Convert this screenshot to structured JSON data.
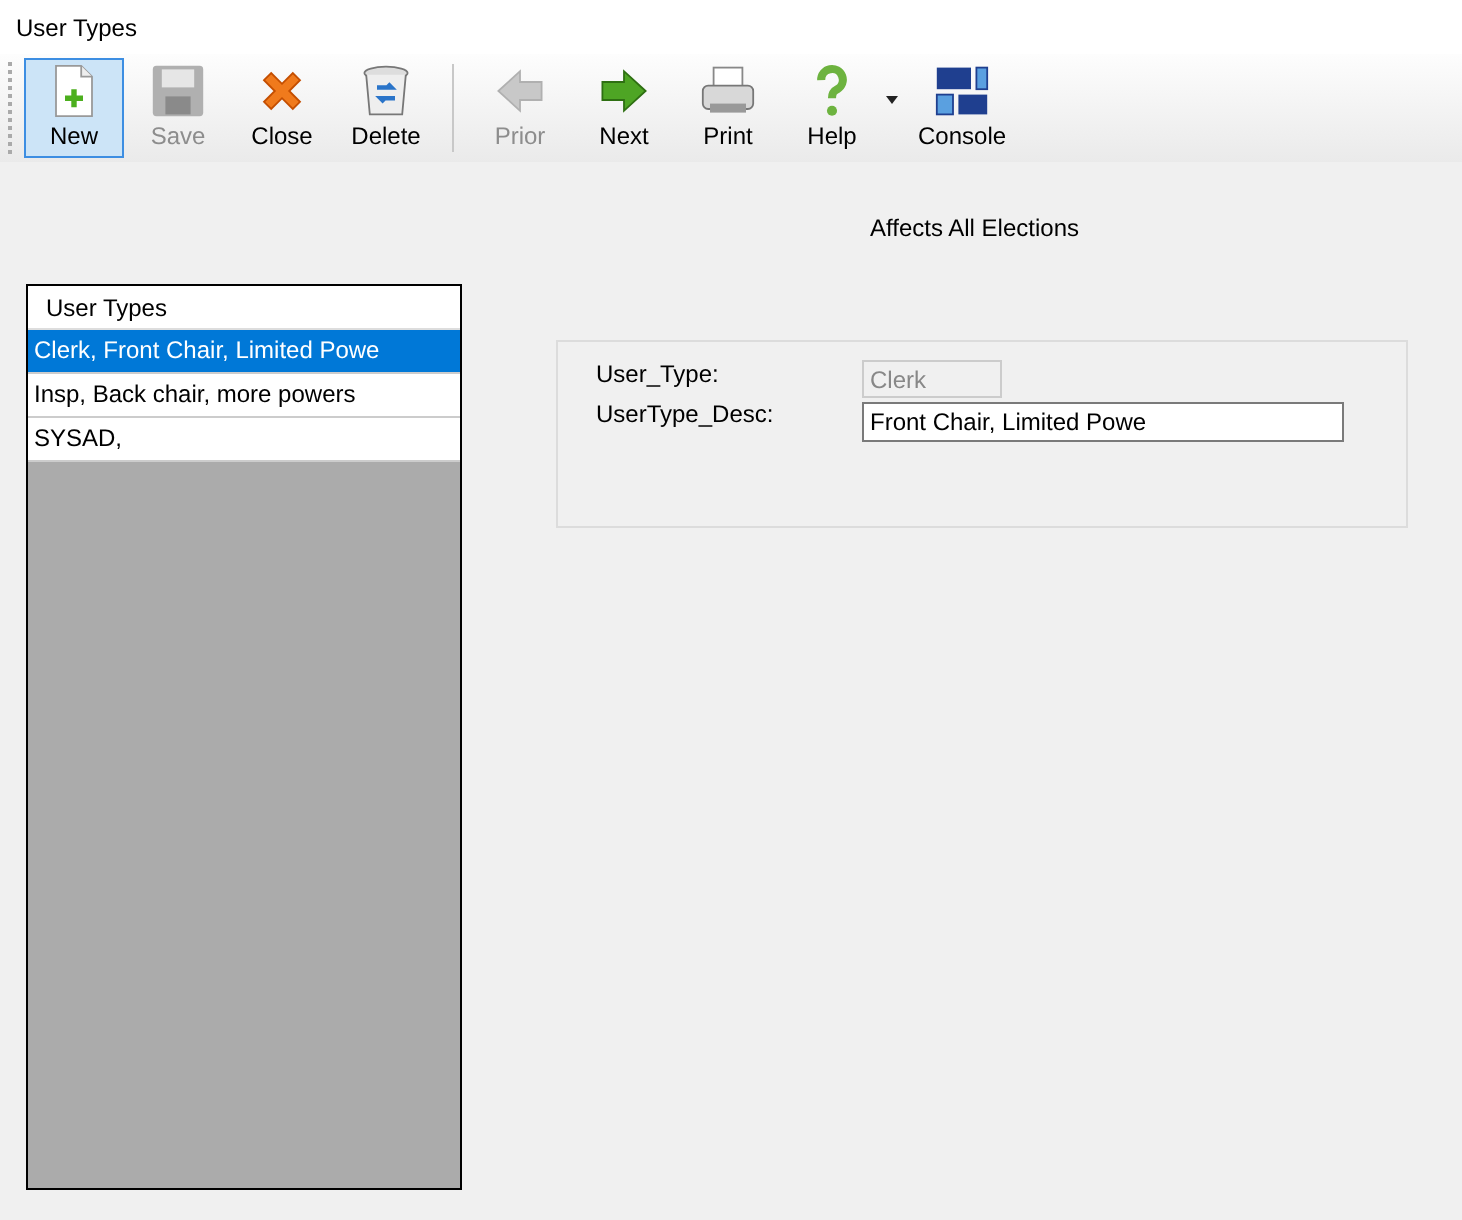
{
  "window": {
    "title": "User Types"
  },
  "toolbar": [
    {
      "kind": "new",
      "label": "New",
      "selected": true,
      "disabled": false
    },
    {
      "kind": "save",
      "label": "Save",
      "selected": false,
      "disabled": true
    },
    {
      "kind": "close",
      "label": "Close",
      "selected": false,
      "disabled": false
    },
    {
      "kind": "delete",
      "label": "Delete",
      "selected": false,
      "disabled": false
    },
    {
      "kind": "prior",
      "label": "Prior",
      "selected": false,
      "disabled": true
    },
    {
      "kind": "next",
      "label": "Next",
      "selected": false,
      "disabled": false
    },
    {
      "kind": "print",
      "label": "Print",
      "selected": false,
      "disabled": false
    },
    {
      "kind": "help",
      "label": "Help",
      "selected": false,
      "disabled": false
    },
    {
      "kind": "console",
      "label": "Console",
      "selected": false,
      "disabled": false
    }
  ],
  "caption": "Affects All Elections",
  "list": {
    "header": "User Types",
    "rows": [
      {
        "text": "Clerk, Front Chair, Limited Powe",
        "selected": true
      },
      {
        "text": "Insp, Back chair, more powers",
        "selected": false
      },
      {
        "text": "SYSAD,",
        "selected": false
      }
    ]
  },
  "form": {
    "fields": [
      {
        "label": "User_Type:",
        "value": "Clerk",
        "disabled": true
      },
      {
        "label": "UserType_Desc:",
        "value": "Front Chair, Limited Powe",
        "disabled": false
      }
    ]
  }
}
